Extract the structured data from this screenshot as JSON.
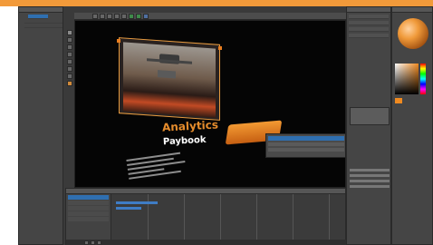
{
  "colors": {
    "accent": "#f29a3a",
    "panel": "#454545",
    "viewport_bg": "#050505",
    "highlight": "#2f6fb0",
    "gizmo_orange": "#e87d1f"
  },
  "viewport": {
    "headline": "Analytics",
    "subhead": "Paybook"
  },
  "icons": {
    "tools": [
      "move-icon",
      "rotate-icon",
      "scale-icon",
      "camera-icon",
      "light-icon",
      "brush-icon",
      "eye-icon",
      "lock-icon"
    ],
    "toolbar": [
      "new-icon",
      "open-icon",
      "save-icon",
      "undo-icon",
      "redo-icon",
      "render-icon",
      "play-icon",
      "grid-icon"
    ]
  }
}
